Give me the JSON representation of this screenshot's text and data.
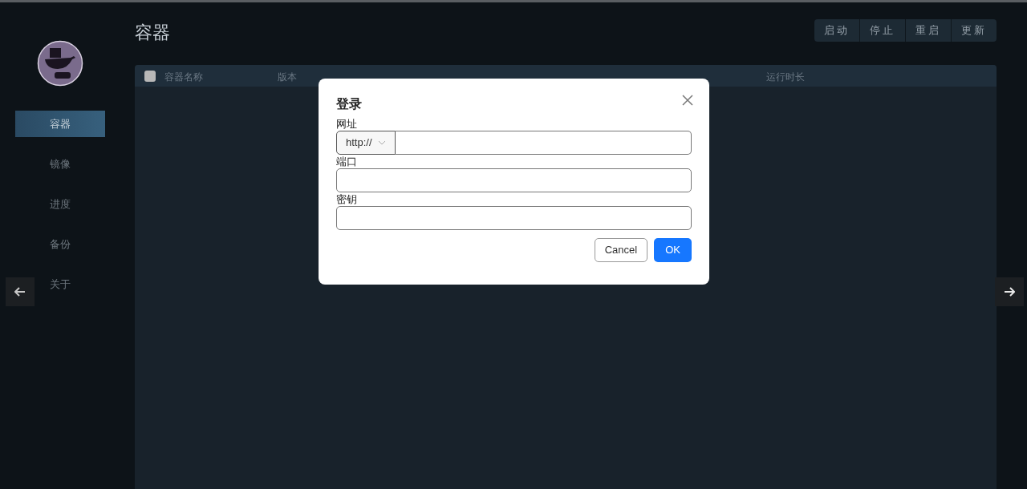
{
  "sidebar": {
    "items": [
      {
        "label": "容器",
        "selected": true
      },
      {
        "label": "镜像",
        "selected": false
      },
      {
        "label": "进度",
        "selected": false
      },
      {
        "label": "备份",
        "selected": false
      },
      {
        "label": "关于",
        "selected": false
      }
    ]
  },
  "page_title": "容器",
  "toolbar": [
    "启动",
    "停止",
    "重启",
    "更新"
  ],
  "table": {
    "select_all_checked": false,
    "columns": [
      "容器名称",
      "版本",
      null,
      null,
      "运行时长"
    ]
  },
  "dialog": {
    "title": "登录",
    "fields": [
      {
        "label": "网址",
        "kind": "prefixed",
        "prefix": "http://"
      },
      {
        "label": "端口",
        "kind": "text"
      },
      {
        "label": "密钥",
        "kind": "text"
      }
    ],
    "buttons": [
      {
        "label": "Cancel",
        "primary": false
      },
      {
        "label": "OK",
        "primary": true
      }
    ]
  }
}
